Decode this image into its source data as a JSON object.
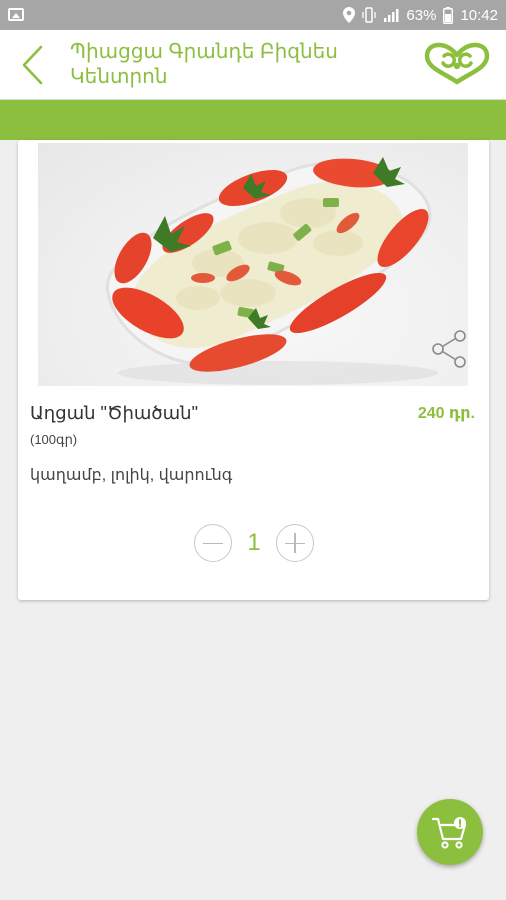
{
  "status_bar": {
    "battery": "63%",
    "time": "10:42",
    "icons": [
      "image-icon",
      "location-icon",
      "vibrate-icon",
      "signal-icon",
      "battery-icon"
    ]
  },
  "header": {
    "title": "Պիացցա Գրանդե Բիզնես Կենտրոն",
    "back_icon": "chevron-left-icon",
    "logo": "brand-logo"
  },
  "product": {
    "name": "Աղցան \"Ծիածան\"",
    "price": "240 դր.",
    "weight": "(100գր)",
    "ingredients": "կաղամբ, լոլիկ, վարունգ",
    "quantity": "1",
    "photo": "salad-photo",
    "share_icon": "share-icon"
  },
  "cart": {
    "icon": "cart-icon"
  },
  "colors": {
    "accent": "#8dbf3f",
    "status_bar": "#a6a6a6",
    "background": "#efefef"
  }
}
